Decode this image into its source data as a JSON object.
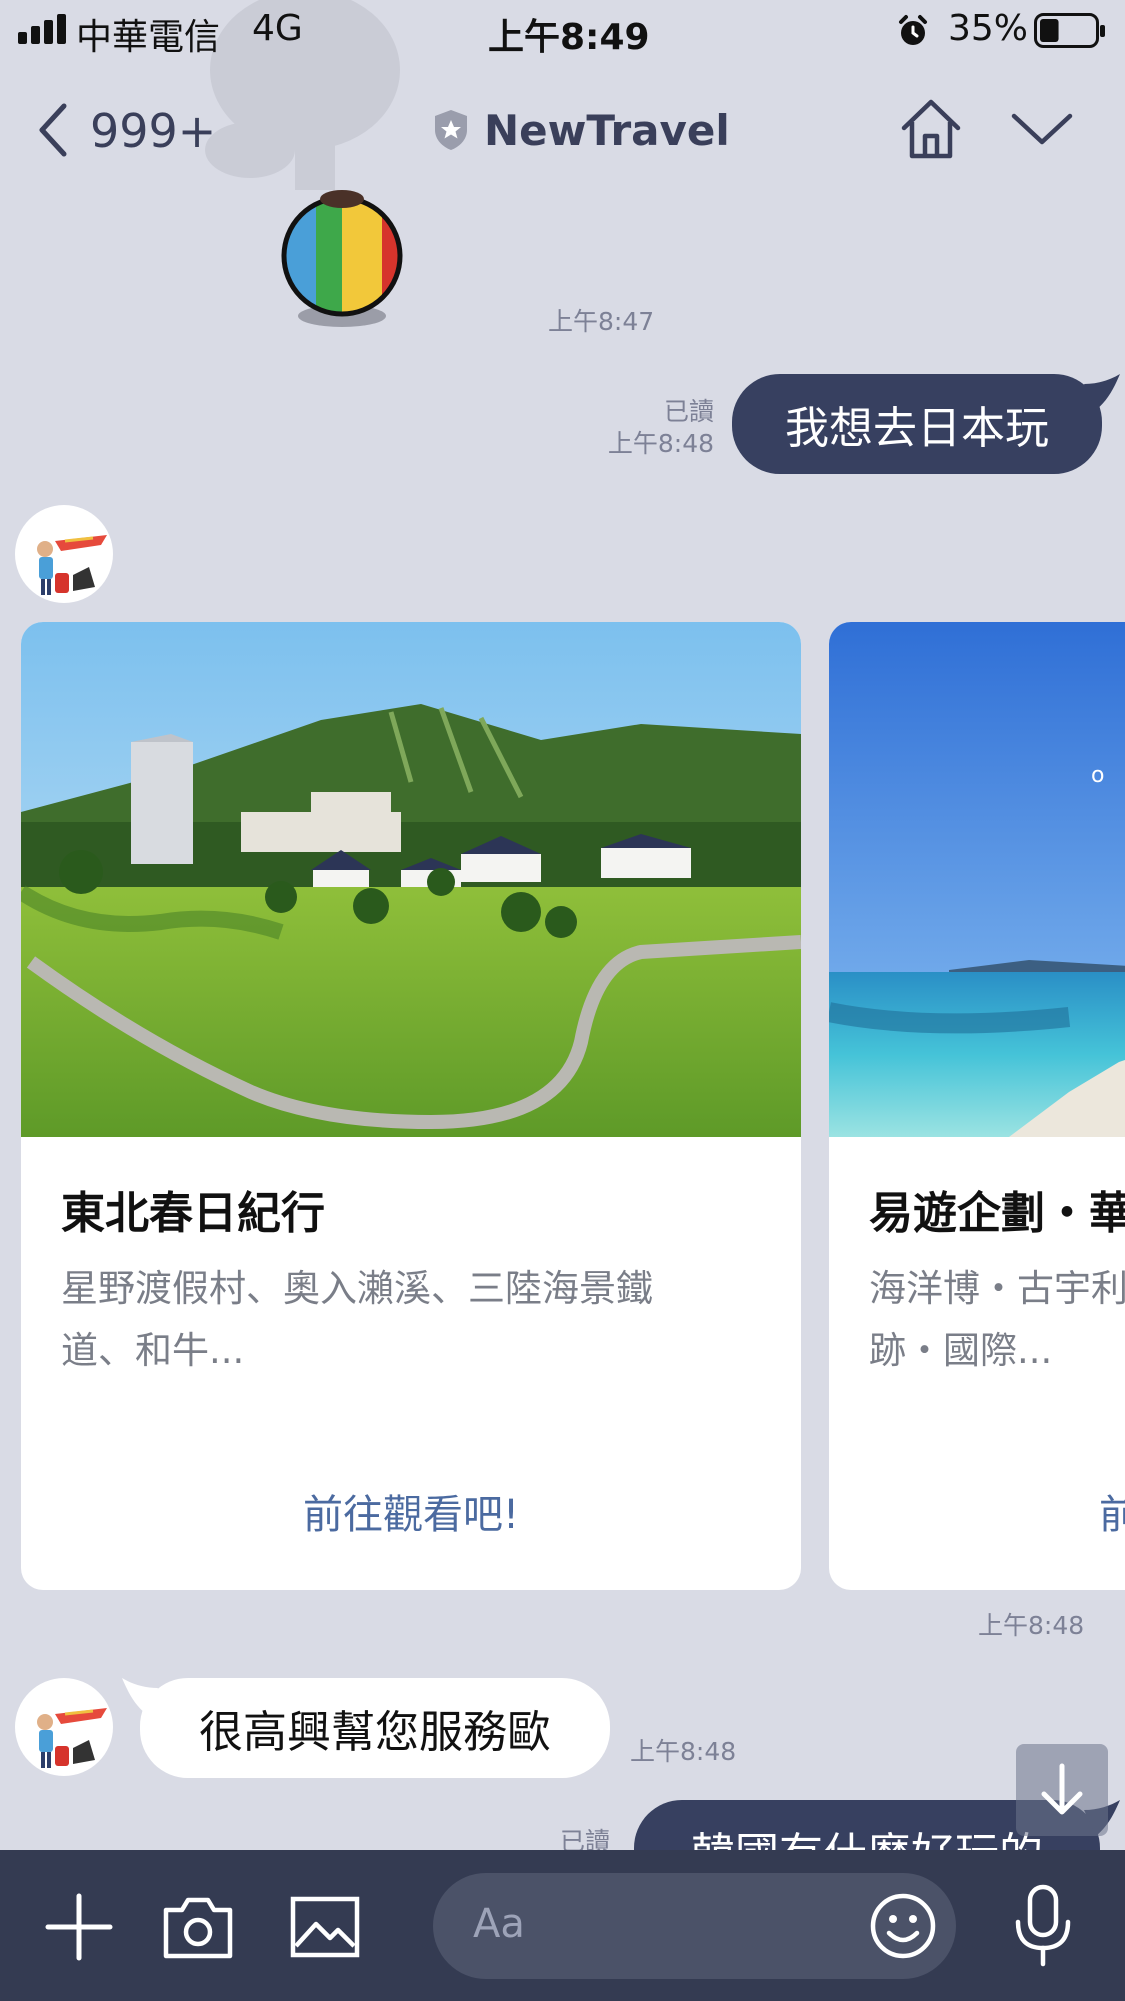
{
  "status_bar": {
    "carrier": "中華電信",
    "network": "4G",
    "time": "上午8:49",
    "battery_percent": "35%",
    "battery_level": 0.35
  },
  "header": {
    "back_count": "999+",
    "title": "NewTravel",
    "icons": [
      "chevron-left-icon",
      "shield-star-icon",
      "home-icon",
      "chevron-down-icon"
    ]
  },
  "messages": {
    "sticker_time": "上午8:47",
    "user_msg_1": {
      "text": "我想去日本玩",
      "read": "已讀",
      "time": "上午8:48"
    },
    "carousel_time": "上午8:48",
    "bot_msg": {
      "text": "很高興幫您服務歐",
      "time": "上午8:48"
    },
    "user_msg_2": {
      "text": "韓國有什麼好玩的",
      "read": "已讀"
    }
  },
  "carousel": [
    {
      "title": "東北春日紀行",
      "desc_line1": "星野渡假村、奧入瀨溪、三陸海景鐵",
      "desc_line2": "道、和牛...",
      "link": "前往觀看吧!"
    },
    {
      "title": "易遊企劃・華",
      "desc_line1": "海洋博・古宇利",
      "desc_line2": "跡・國際...",
      "link": "前"
    }
  ],
  "composer": {
    "placeholder": "Aa",
    "icons": [
      "plus-icon",
      "camera-icon",
      "image-icon",
      "smiley-icon",
      "microphone-icon"
    ]
  },
  "colors": {
    "background": "#d9dbe5",
    "dark_bubble": "#374060",
    "bottom_bar": "#343b52",
    "link": "#4b6aa0"
  }
}
